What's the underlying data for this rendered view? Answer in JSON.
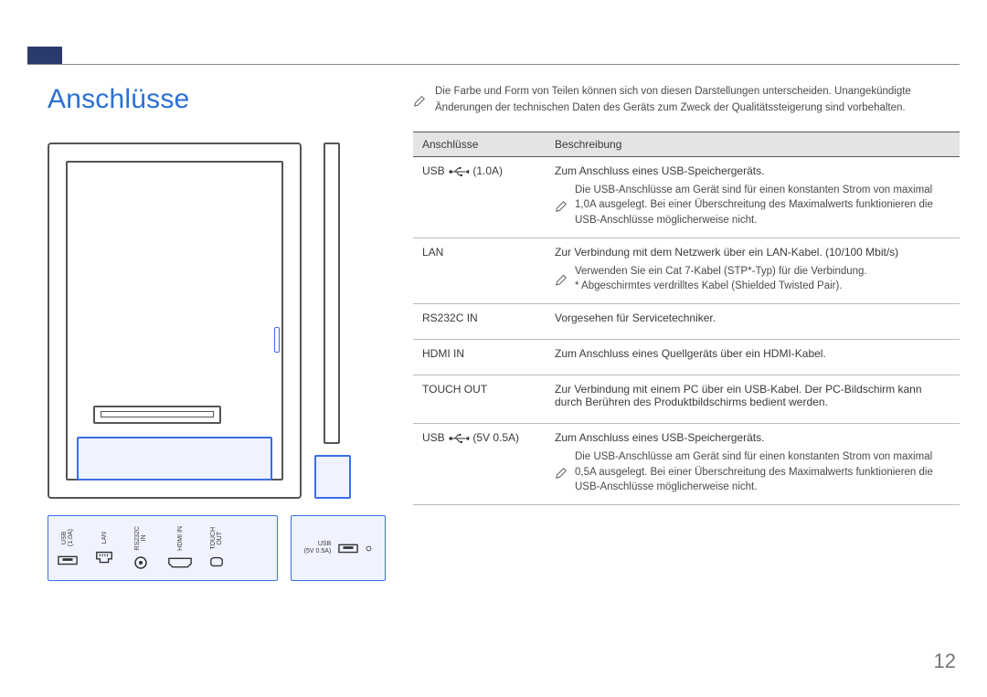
{
  "page": {
    "title": "Anschlüsse",
    "number": "12",
    "top_note": "Die Farbe und Form von Teilen können sich von diesen Darstellungen unterscheiden. Unangekündigte Änderungen der technischen Daten des Geräts zum Zweck der Qualitätssteigerung sind vorbehalten."
  },
  "ports_main": [
    {
      "id": "usb-1a",
      "label": "USB\n(1.0A)",
      "icon": "usb"
    },
    {
      "id": "lan",
      "label": "LAN",
      "icon": "rj45"
    },
    {
      "id": "rs232c",
      "label": "RS232C\nIN",
      "icon": "jack"
    },
    {
      "id": "hdmi",
      "label": "HDMI IN",
      "icon": "hdmi"
    },
    {
      "id": "touch",
      "label": "TOUCH\nOUT",
      "icon": "microb"
    }
  ],
  "ports_side": [
    {
      "id": "usb-05a",
      "label": "USB\n(5V 0.5A)",
      "icon": "usb"
    }
  ],
  "table": {
    "headers": {
      "col1": "Anschlüsse",
      "col2": "Beschreibung"
    },
    "rows": [
      {
        "port_prefix": "USB ",
        "port_usb_glyph": true,
        "port_suffix": " (1.0A)",
        "desc": "Zum Anschluss eines USB-Speichergeräts.",
        "note": "Die USB-Anschlüsse am Gerät sind für einen konstanten Strom von maximal 1,0A ausgelegt. Bei einer Überschreitung des Maximalwerts funktionieren die USB-Anschlüsse möglicherweise nicht."
      },
      {
        "port": "LAN",
        "desc": "Zur Verbindung mit dem Netzwerk über ein LAN-Kabel. (10/100 Mbit/s)",
        "note": "Verwenden Sie ein Cat 7-Kabel (STP*-Typ) für die Verbindung.\n* Abgeschirmtes verdrilltes Kabel (Shielded Twisted Pair)."
      },
      {
        "port": "RS232C IN",
        "desc": "Vorgesehen für Servicetechniker."
      },
      {
        "port": "HDMI IN",
        "desc": "Zum Anschluss eines Quellgeräts über ein HDMI-Kabel."
      },
      {
        "port": "TOUCH OUT",
        "desc": "Zur Verbindung mit einem PC über ein USB-Kabel. Der PC-Bildschirm kann durch Berühren des Produktbildschirms bedient werden."
      },
      {
        "port_prefix": "USB ",
        "port_usb_glyph": true,
        "port_suffix": " (5V 0.5A)",
        "desc": "Zum Anschluss eines USB-Speichergeräts.",
        "note": "Die USB-Anschlüsse am Gerät sind für einen konstanten Strom von maximal 0,5A ausgelegt. Bei einer Überschreitung des Maximalwerts funktionieren die USB-Anschlüsse möglicherweise nicht."
      }
    ]
  }
}
